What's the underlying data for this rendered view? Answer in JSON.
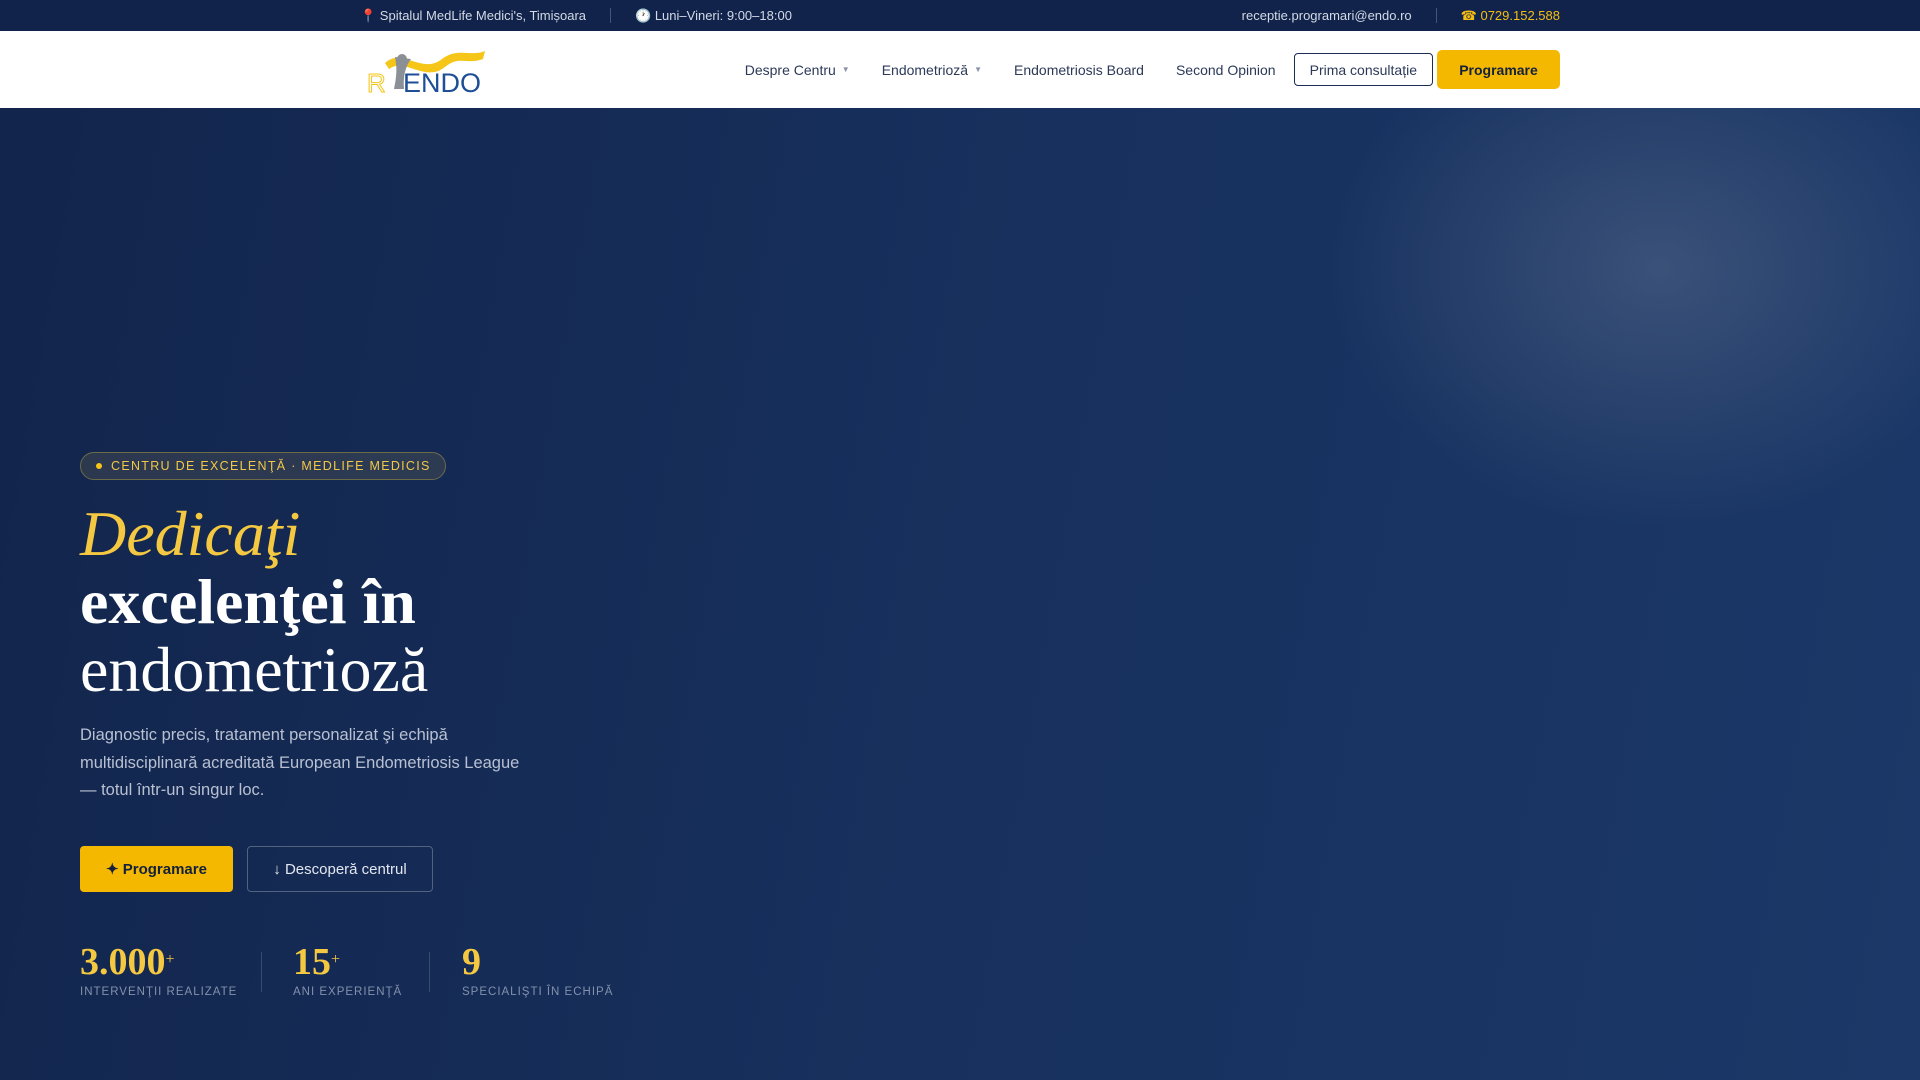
{
  "topbar": {
    "location": "📍 Spitalul MedLife Medici's, Timișoara",
    "hours": "🕐 Luni–Vineri: 9:00–18:00",
    "email": "receptie.programari@endo.ro",
    "phone": "☎ 0729.152.588"
  },
  "logo": {
    "text": "ROENDO"
  },
  "nav": {
    "items": [
      "Despre Centru",
      "Endometrioză",
      "Endometriosis Board",
      "Second Opinion"
    ],
    "outline_button": "Prima consultație",
    "primary_button": "Programare"
  },
  "hero": {
    "badge": "CENTRU DE EXCELENŢĂ · MEDLIFE MEDICIS",
    "title_line1": "Dedicaţi",
    "title_line2": "excelenţei în",
    "title_line3": "endometrioză",
    "lead": "Diagnostic precis, tratament personalizat şi echipă multidisciplinară acreditată European Endometriosis League — totul într-un singur loc.",
    "cta_primary": "✦ Programare",
    "cta_secondary": "↓ Descoperă centrul",
    "stats": [
      {
        "value": "3.000",
        "suffix": "+",
        "label": "INTERVENŢII REALIZATE"
      },
      {
        "value": "15",
        "suffix": "+",
        "label": "ANI EXPERIENŢĂ"
      },
      {
        "value": "9",
        "suffix": "",
        "label": "SPECIALIŞTI ÎN ECHIPĂ"
      }
    ]
  },
  "colors": {
    "navy": "#12254c",
    "accent": "#f5b800",
    "gold_text": "#f5c842"
  }
}
